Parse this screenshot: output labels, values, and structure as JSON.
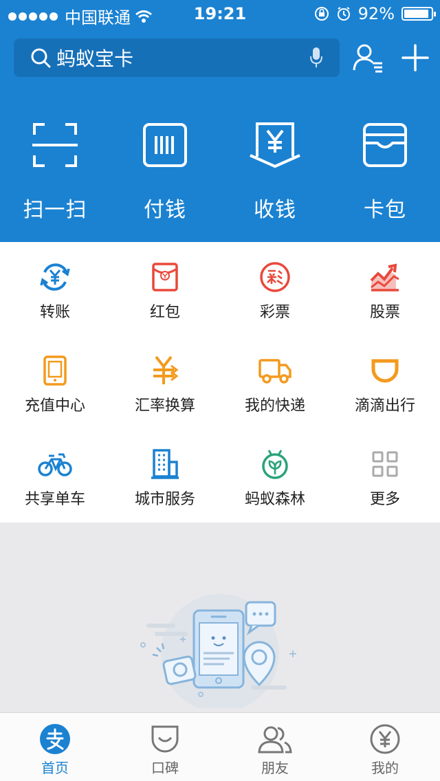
{
  "status_bar": {
    "carrier": "中国联通",
    "time": "19:21",
    "battery": "92%",
    "battery_level": 0.92
  },
  "search": {
    "text": "蚂蚁宝卡"
  },
  "quick_actions": [
    {
      "label": "扫一扫",
      "icon": "scan-icon"
    },
    {
      "label": "付钱",
      "icon": "barcode-icon"
    },
    {
      "label": "收钱",
      "icon": "yuan-envelope-icon"
    },
    {
      "label": "卡包",
      "icon": "card-wallet-icon"
    }
  ],
  "services": [
    {
      "label": "转账",
      "icon": "transfer-icon",
      "color": "#1b82d2"
    },
    {
      "label": "红包",
      "icon": "red-envelope-icon",
      "color": "#e8493b"
    },
    {
      "label": "彩票",
      "icon": "lottery-icon",
      "color": "#e8493b"
    },
    {
      "label": "股票",
      "icon": "stock-icon",
      "color": "#e8493b"
    },
    {
      "label": "充值中心",
      "icon": "phone-topup-icon",
      "color": "#f39a1e"
    },
    {
      "label": "汇率换算",
      "icon": "exchange-rate-icon",
      "color": "#f39a1e"
    },
    {
      "label": "我的快递",
      "icon": "delivery-truck-icon",
      "color": "#f39a1e"
    },
    {
      "label": "滴滴出行",
      "icon": "didi-icon",
      "color": "#f39a1e"
    },
    {
      "label": "共享单车",
      "icon": "bicycle-icon",
      "color": "#1b82d2"
    },
    {
      "label": "城市服务",
      "icon": "city-building-icon",
      "color": "#1b82d2"
    },
    {
      "label": "蚂蚁森林",
      "icon": "ant-forest-icon",
      "color": "#2ba37a"
    },
    {
      "label": "更多",
      "icon": "more-grid-icon",
      "color": "#aaaaaa"
    }
  ],
  "tabs": [
    {
      "label": "首页",
      "icon": "alipay-home-icon",
      "active": true
    },
    {
      "label": "口碑",
      "icon": "koubei-icon",
      "active": false
    },
    {
      "label": "朋友",
      "icon": "friends-icon",
      "active": false
    },
    {
      "label": "我的",
      "icon": "my-account-icon",
      "active": false
    }
  ],
  "colors": {
    "brand_blue": "#1b82d2",
    "search_bg": "#1670b8",
    "background": "#e9e9ec"
  }
}
